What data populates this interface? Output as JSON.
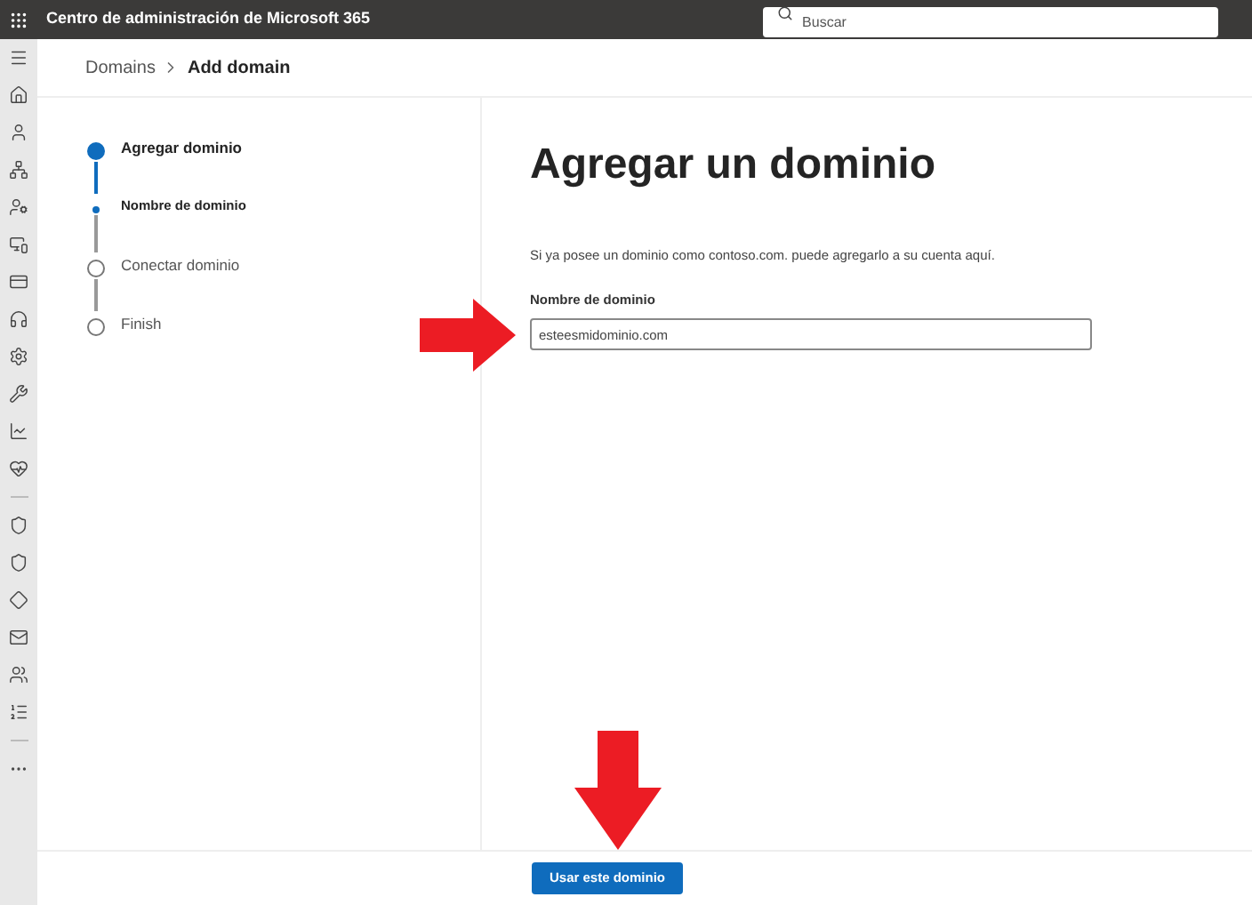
{
  "app_bar": {
    "title": "Centro de administración de Microsoft 365",
    "search": {
      "placeholder": "Buscar"
    }
  },
  "breadcrumb": [
    {
      "label": "Domains",
      "current": false
    },
    {
      "label": "Add domain",
      "current": true
    }
  ],
  "steps": [
    {
      "kind": "main",
      "label": "Agregar dominio",
      "active": true
    },
    {
      "kind": "sub",
      "label": "Nombre de dominio",
      "active": true
    },
    {
      "kind": "main",
      "label": "Conectar dominio",
      "active": false
    },
    {
      "kind": "main",
      "label": "Finish",
      "active": false
    }
  ],
  "page": {
    "title": "Agregar un dominio",
    "description": "Si ya posee un dominio como contoso.com. puede agregarlo a su cuenta aquí.",
    "field": {
      "label": "Nombre de dominio",
      "value": "esteesmidominio.com"
    }
  },
  "footer": {
    "primary_button": "Usar este dominio"
  }
}
